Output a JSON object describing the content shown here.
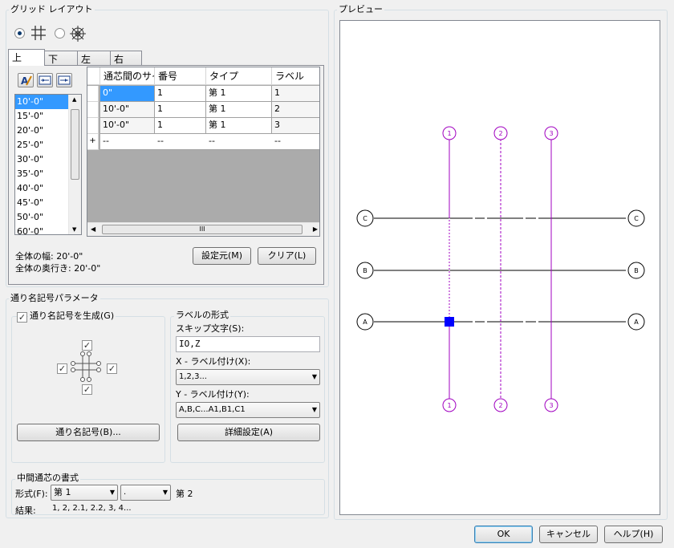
{
  "grid_layout": {
    "title": "グリッド レイアウト",
    "tabs": [
      "上",
      "下",
      "左",
      "右"
    ],
    "spacing_list": [
      "10'-0\"",
      "15'-0\"",
      "20'-0\"",
      "25'-0\"",
      "30'-0\"",
      "35'-0\"",
      "40'-0\"",
      "45'-0\"",
      "50'-0\"",
      "60'-0\""
    ],
    "table": {
      "headers": [
        "通芯間のサイズ",
        "番号",
        "タイプ",
        "ラベル"
      ],
      "rows": [
        [
          "0\"",
          "1",
          "第 1",
          "1"
        ],
        [
          "10'-0\"",
          "1",
          "第 1",
          "2"
        ],
        [
          "10'-0\"",
          "1",
          "第 1",
          "3"
        ],
        [
          "--",
          "--",
          "--",
          "--"
        ]
      ],
      "new_row_marker": "+",
      "scroll_grip": "III"
    },
    "total_width": "全体の幅: 20'-0\"",
    "total_depth": "全体の奥行き: 20'-0\"",
    "set_origin_button": "設定元(M)",
    "clear_button": "クリア(L)"
  },
  "bubble_params": {
    "title": "通り名記号パラメータ",
    "generate_checkbox": "通り名記号を生成(G)",
    "bubbles_button": "通り名記号(B)...",
    "label_format_title": "ラベルの形式",
    "skip_chars_label": "スキップ文字(S):",
    "skip_chars_value": "IO,Z",
    "x_label_caption": "X - ラベル付け(X):",
    "x_label_value": "1,2,3...",
    "y_label_caption": "Y - ラベル付け(Y):",
    "y_label_value": "A,B,C...A1,B1,C1",
    "advanced_button": "詳細設定(A)"
  },
  "intermediate": {
    "title": "中間通芯の書式",
    "format_label": "形式(F):",
    "format_value": "第 1",
    "separator_value": ".",
    "suffix_text": "第 2",
    "result_label": "結果:",
    "result_value": "1, 2, 2.1, 2.2, 3, 4..."
  },
  "preview": {
    "title": "プレビュー",
    "x_labels": [
      "1",
      "2",
      "3"
    ],
    "y_labels": [
      "C",
      "B",
      "A"
    ],
    "line_color": "#a000c0",
    "accent_marker": "#0000ff"
  },
  "footer": {
    "ok": "OK",
    "cancel": "キャンセル",
    "help": "ヘルプ(H)"
  }
}
